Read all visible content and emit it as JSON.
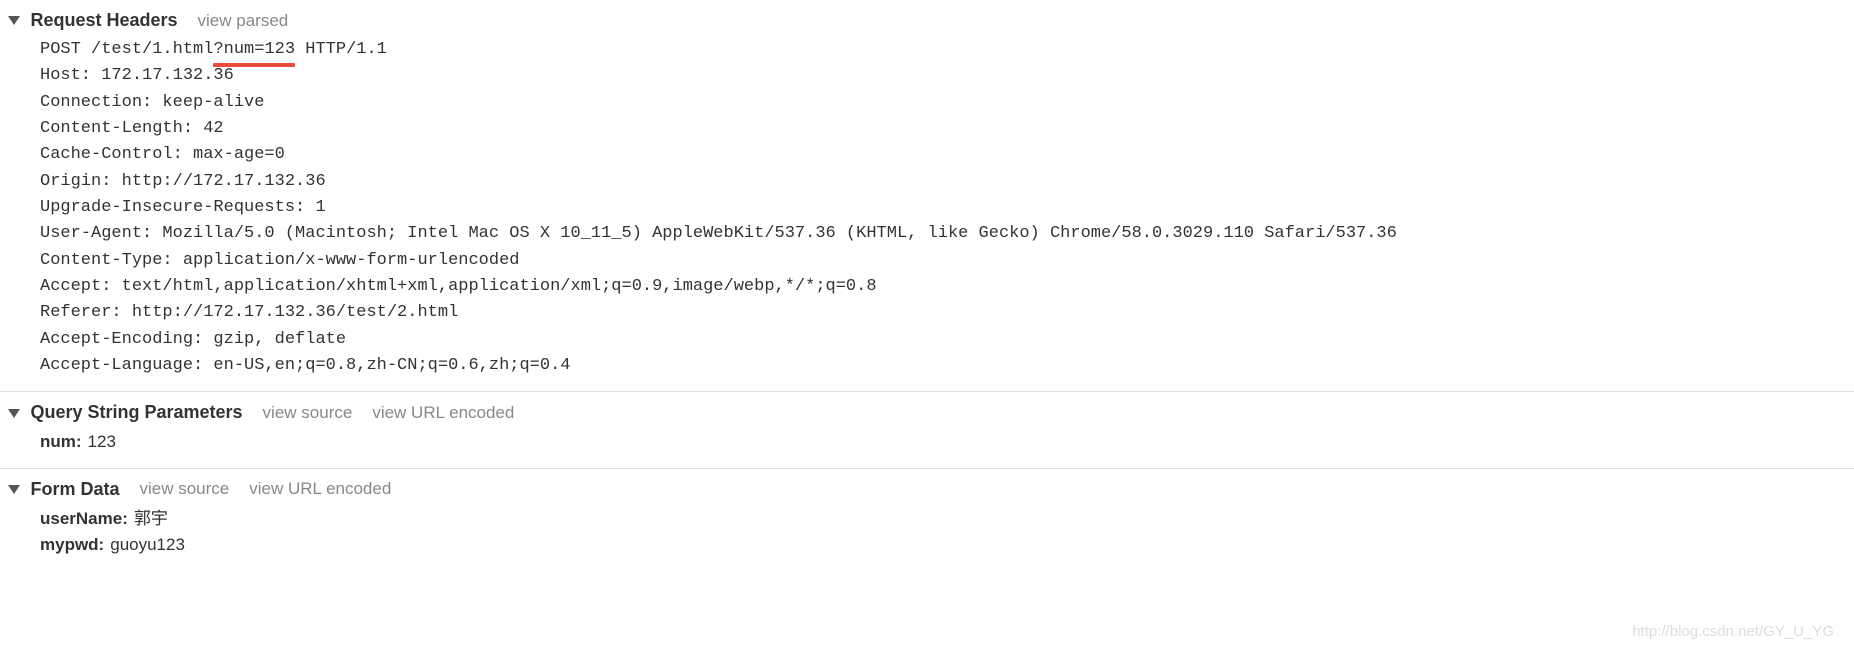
{
  "sections": {
    "requestHeaders": {
      "title": "Request Headers",
      "action": "view parsed",
      "request_line": {
        "pre": "POST /test/1.html",
        "query": "?num=123",
        "post": " HTTP/1.1"
      },
      "headers": [
        "Host: 172.17.132.36",
        "Connection: keep-alive",
        "Content-Length: 42",
        "Cache-Control: max-age=0",
        "Origin: http://172.17.132.36",
        "Upgrade-Insecure-Requests: 1",
        "User-Agent: Mozilla/5.0 (Macintosh; Intel Mac OS X 10_11_5) AppleWebKit/537.36 (KHTML, like Gecko) Chrome/58.0.3029.110 Safari/537.36",
        "Content-Type: application/x-www-form-urlencoded",
        "Accept: text/html,application/xhtml+xml,application/xml;q=0.9,image/webp,*/*;q=0.8",
        "Referer: http://172.17.132.36/test/2.html",
        "Accept-Encoding: gzip, deflate",
        "Accept-Language: en-US,en;q=0.8,zh-CN;q=0.6,zh;q=0.4"
      ]
    },
    "queryString": {
      "title": "Query String Parameters",
      "action1": "view source",
      "action2": "view URL encoded",
      "params": [
        {
          "key": "num:",
          "value": "123"
        }
      ]
    },
    "formData": {
      "title": "Form Data",
      "action1": "view source",
      "action2": "view URL encoded",
      "params": [
        {
          "key": "userName:",
          "value": "郭宇"
        },
        {
          "key": "mypwd:",
          "value": "guoyu123"
        }
      ]
    }
  },
  "watermark": "http://blog.csdn.net/GY_U_YG"
}
